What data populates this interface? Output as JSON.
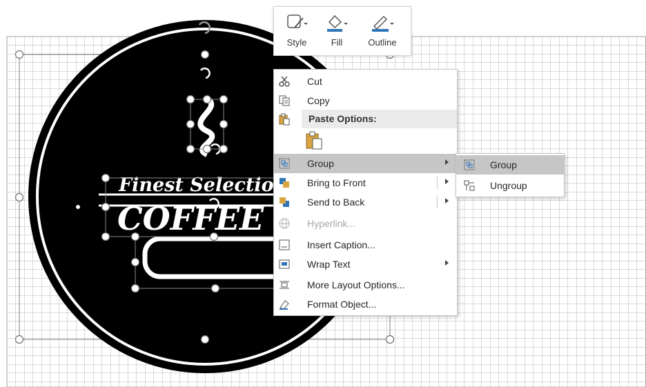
{
  "mini_toolbar": {
    "style_label": "Style",
    "fill_label": "Fill",
    "outline_label": "Outline"
  },
  "logo": {
    "line1": "Finest Selectio",
    "line2": "COFFEE"
  },
  "context_menu": {
    "cut": {
      "label": "Cut",
      "icon": "scissors-icon"
    },
    "copy": {
      "label": "Copy",
      "icon": "copy-icon"
    },
    "paste_options": {
      "label": "Paste Options:",
      "icon": "paste-icon"
    },
    "group": {
      "label": "Group",
      "icon": "group-icon"
    },
    "bring_to_front": {
      "label": "Bring to Front",
      "icon": "bring-to-front-icon"
    },
    "send_to_back": {
      "label": "Send to Back",
      "icon": "send-to-back-icon"
    },
    "hyperlink": {
      "label": "Hyperlink...",
      "icon": "hyperlink-icon"
    },
    "insert_caption": {
      "label": "Insert Caption...",
      "icon": "insert-caption-icon"
    },
    "wrap_text": {
      "label": "Wrap Text",
      "icon": "wrap-text-icon"
    },
    "more_layout": {
      "label": "More Layout Options...",
      "icon": "layout-options-icon"
    },
    "format_object": {
      "label": "Format Object...",
      "icon": "format-object-icon"
    }
  },
  "submenu": {
    "group": {
      "label": "Group",
      "icon": "group-icon"
    },
    "ungroup": {
      "label": "Ungroup",
      "icon": "ungroup-icon"
    }
  },
  "colors": {
    "accent_blue": "#2e75b6",
    "menu_hover": "#c6c6c6",
    "grid": "#b4b4b4"
  }
}
